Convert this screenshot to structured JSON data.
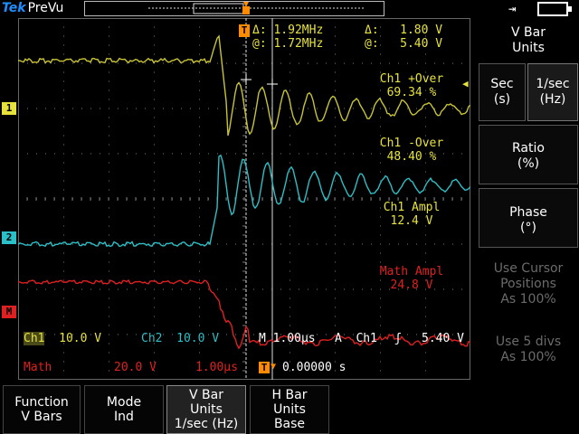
{
  "status": {
    "brand": "Tek",
    "mode": "PreVu"
  },
  "cursor": {
    "delta_freq": "1.92MHz",
    "at_freq": "1.72MHz",
    "delta_volt": "1.80 V",
    "at_volt": "5.40 V",
    "delta_symbol": "Δ:",
    "at_symbol": "@:"
  },
  "measurements": [
    {
      "label": "Ch1 +Over",
      "value": "69.34 %",
      "color": "#e6e23c"
    },
    {
      "label": "Ch1 -Over",
      "value": "48.40 %",
      "color": "#e6e23c"
    },
    {
      "label": "Ch1 Ampl",
      "value": "12.4 V",
      "color": "#e6e23c"
    },
    {
      "label": "Math Ampl",
      "value": "24.8 V",
      "color": "#e02020"
    }
  ],
  "channels": {
    "ch1_label": "Ch1",
    "ch1_scale": "10.0 V",
    "ch2_label": "Ch2",
    "ch2_scale": "10.0 V",
    "math_label": "Math",
    "math_scale": "20.0 V",
    "math_time": "1.00µs",
    "timebase": "M 1.00µs",
    "trigger_source": "A  Ch1",
    "trigger_level": "5.40 V",
    "trigger_pos": "0.00000 s"
  },
  "markers": {
    "ch1": "1",
    "ch2": "2",
    "math": "M",
    "trigger": "T"
  },
  "side_menu": {
    "title": "V Bar\nUnits",
    "sec": "Sec\n(s)",
    "hz": "1/sec\n(Hz)",
    "ratio": "Ratio\n(%)",
    "phase": "Phase\n(°)",
    "cursor_pos": "Use Cursor\nPositions\nAs 100%",
    "divs": "Use 5 divs\nAs 100%"
  },
  "bottom_menu": [
    {
      "label": "Function\nV Bars"
    },
    {
      "label": "Mode\nInd"
    },
    {
      "label": "V Bar\nUnits\n1/sec (Hz)"
    },
    {
      "label": "H Bar\nUnits\nBase"
    }
  ],
  "colors": {
    "ch1": "#e6e23c",
    "ch2": "#2bbfc7",
    "math": "#e02020",
    "brand": "#1f8fff"
  }
}
